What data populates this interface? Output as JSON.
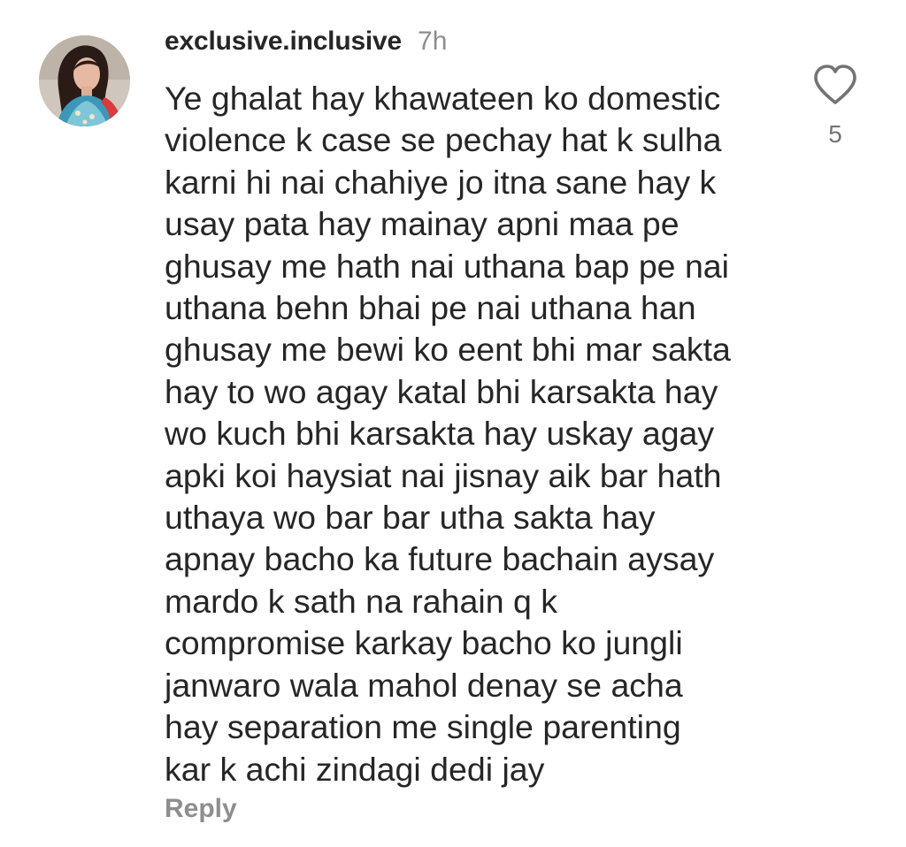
{
  "comment": {
    "username": "exclusive.inclusive",
    "timestamp": "7h",
    "text_lines": [
      "Ye ghalat hay khawateen ko domestic",
      "violence k case se pechay hat k sulha",
      "karni hi nai chahiye jo itna sane hay k",
      "usay pata hay mainay apni maa pe",
      "ghusay me hath nai uthana bap pe nai",
      "uthana behn bhai pe nai uthana han",
      "ghusay me bewi ko eent bhi mar sakta",
      "hay to wo agay katal bhi karsakta hay",
      "wo kuch bhi karsakta hay uskay agay",
      "apki koi haysiat nai jisnay aik bar hath",
      "uthaya wo bar bar utha sakta hay",
      "apnay bacho ka future bachain aysay",
      "mardo k sath na rahain q k",
      "compromise karkay bacho ko jungli",
      "janwaro wala mahol denay se acha",
      "hay separation me single parenting",
      "kar k achi zindagi dedi jay"
    ],
    "like_count": "5",
    "reply_label": "Reply",
    "like_icon": "heart-outline-icon"
  },
  "colors": {
    "text": "#262626",
    "muted": "#8e8e8e",
    "icon": "#737373"
  }
}
